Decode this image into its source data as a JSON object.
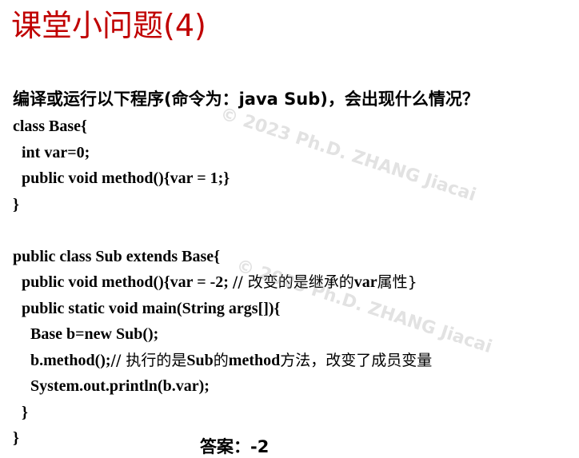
{
  "title": "课堂小问题(4)",
  "question": "编译或运行以下程序(命令为：java Sub)，会出现什么情况？",
  "code": {
    "l1": "class Base{",
    "l2": "int var=0;",
    "l3": "public void method(){var = 1;}",
    "l4": "}",
    "l5": "public class Sub extends Base{",
    "l6_code": "public void method(){var = -2;  ",
    "l6_comment_a": "// 改变的是继承的",
    "l6_comment_b": "var",
    "l6_comment_c": "属性}",
    "l7": "public static void main(String args[]){",
    "l8": "Base b=new Sub();",
    "l9_code": "b.method();",
    "l9_comment_a": "// 执行的是",
    "l9_comment_b": "Sub",
    "l9_comment_c": "的",
    "l9_comment_d": "method",
    "l9_comment_e": "方法，改变了成员变量",
    "l10": "System.out.println(b.var);",
    "l11": "}",
    "l12": "}"
  },
  "answer": "答案：-2",
  "watermark": "© 2023 Ph.D. ZHANG Jiacai",
  "colors": {
    "title": "#c00000",
    "text": "#000000",
    "watermark": "rgba(150,150,150,0.28)"
  }
}
